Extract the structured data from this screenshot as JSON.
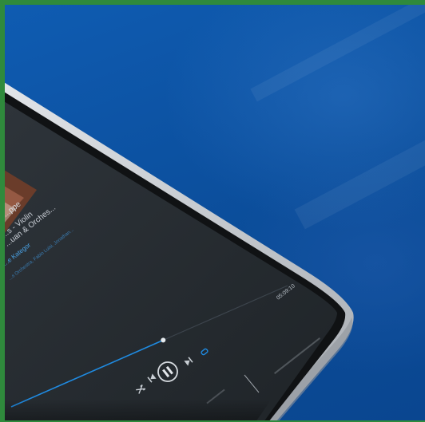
{
  "colors": {
    "background": "#0e55a8",
    "frame_border": "#2f8a3c",
    "device_body": "#c8ccd1",
    "screen": "#262c31",
    "accent": "#1f8ae0"
  },
  "player": {
    "track_title": "...ppe",
    "artist_line": "...s - Violin",
    "album_line": "...uan & Orches...",
    "link_label": "...e Kategor",
    "credits": "...s Orchestra, Fabio Luisi, Jonathan...",
    "time_elapsed": "05:09:10",
    "progress": 0.55,
    "state": "playing"
  },
  "icons": {
    "shuffle": "shuffle-icon",
    "previous": "skip-back-icon",
    "play_pause": "pause-icon",
    "next": "skip-forward-icon",
    "repeat": "repeat-icon"
  }
}
